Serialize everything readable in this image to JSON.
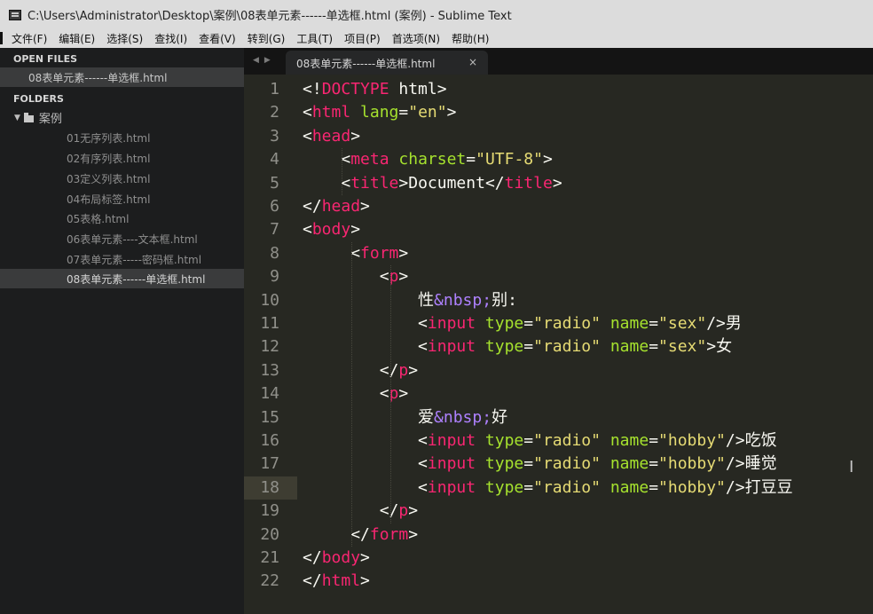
{
  "window": {
    "title": "C:\\Users\\Administrator\\Desktop\\案例\\08表单元素------单选框.html (案例) - Sublime Text"
  },
  "menu": [
    "文件(F)",
    "编辑(E)",
    "选择(S)",
    "查找(I)",
    "查看(V)",
    "转到(G)",
    "工具(T)",
    "项目(P)",
    "首选项(N)",
    "帮助(H)"
  ],
  "sidebar": {
    "open_files_label": "OPEN FILES",
    "open_files": [
      "08表单元素------单选框.html"
    ],
    "folders_label": "FOLDERS",
    "folder": {
      "name": "案例",
      "files": [
        "01无序列表.html",
        "02有序列表.html",
        "03定义列表.html",
        "04布局标签.html",
        "05表格.html",
        "06表单元素----文本框.html",
        "07表单元素-----密码框.html",
        "08表单元素------单选框.html"
      ]
    }
  },
  "tab": {
    "label": "08表单元素------单选框.html",
    "close": "×"
  },
  "editor": {
    "current_line": 18,
    "lines": [
      "<!DOCTYPE html>",
      "<html lang=\"en\">",
      "<head>",
      "    <meta charset=\"UTF-8\">",
      "    <title>Document</title>",
      "</head>",
      "<body>",
      "     <form>",
      "        <p>",
      "            性&nbsp;别:",
      "            <input type=\"radio\" name=\"sex\"/>男",
      "            <input type=\"radio\" name=\"sex\">女",
      "        </p>",
      "        <p>",
      "            爱&nbsp;好",
      "            <input type=\"radio\" name=\"hobby\"/>吃饭",
      "            <input type=\"radio\" name=\"hobby\"/>睡觉",
      "            <input type=\"radio\" name=\"hobby\"/>打豆豆",
      "        </p>",
      "     </form>",
      "</body>",
      "</html>"
    ]
  },
  "colors": {
    "tag": "#f92672",
    "attr": "#a6e22e",
    "string": "#e6db74",
    "entity": "#ae81ff",
    "text": "#f8f8f2"
  },
  "icons": {
    "window": "sublime-window-icon",
    "folder": "folder-icon",
    "expand": "triangle-down-icon",
    "tab_nav": "tab-nav-arrows-icon",
    "text_cursor": "text-cursor-icon"
  }
}
